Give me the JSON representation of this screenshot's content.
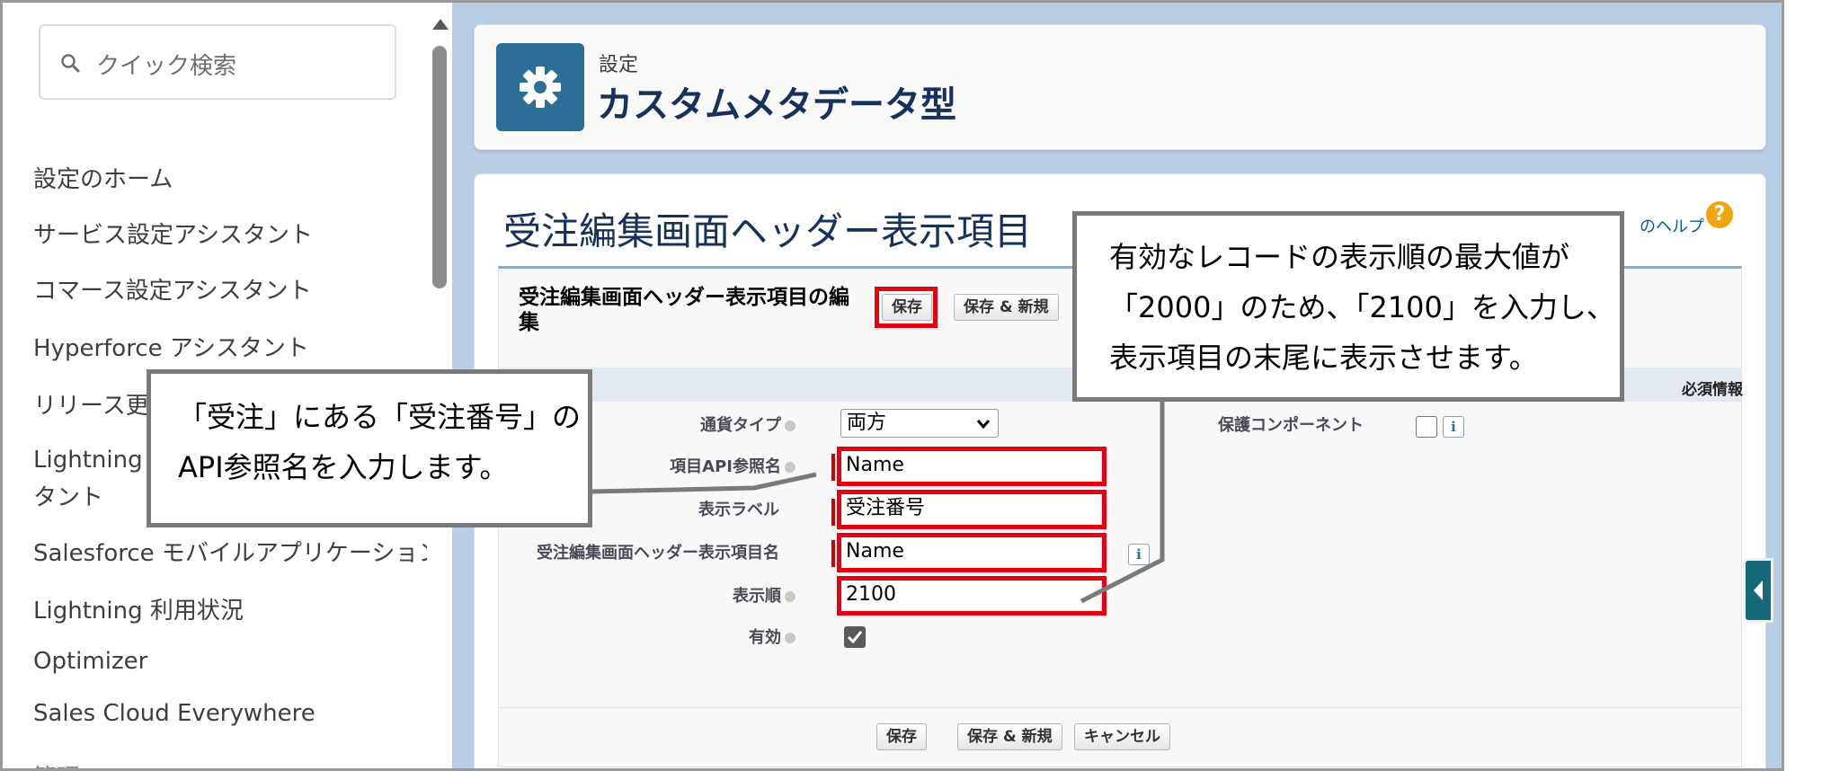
{
  "sidebar": {
    "search_placeholder": "クイック検索",
    "items": [
      "設定のホーム",
      "サービス設定アシスタント",
      "コマース設定アシスタント",
      "Hyperforce アシスタント",
      "リリース更",
      "Lightning E",
      "タント",
      "Salesforce モバイルアプリケーション",
      "Lightning 利用状況",
      "Optimizer",
      "Sales Cloud Everywhere",
      "管理"
    ]
  },
  "header": {
    "subtitle": "設定",
    "title": "カスタムメタデータ型"
  },
  "page": {
    "title": "受注編集画面ヘッダー表示項目",
    "help_link": "のヘルプ",
    "help_icon": "?"
  },
  "edit": {
    "title": "受注編集画面ヘッダー表示項目の編集",
    "top_buttons": {
      "save": "保存",
      "save_new": "保存 & 新規"
    },
    "required_info": "必須情報",
    "fields": {
      "currency_label": "通貨タイプ",
      "currency_value": "両方",
      "api_label": "項目API参照名",
      "api_value": "Name",
      "display_label_label": "表示ラベル",
      "display_label_value": "受注番号",
      "name_label": "受注編集画面ヘッダー表示項目名",
      "name_value": "Name",
      "order_label": "表示順",
      "order_value": "2100",
      "active_label": "有効",
      "active_checked": true,
      "protected_label": "保護コンポーネント",
      "protected_checked": false,
      "info_glyph": "i"
    },
    "bottom_buttons": {
      "save": "保存",
      "save_new": "保存 & 新規",
      "cancel": "キャンセル"
    }
  },
  "callouts": {
    "left": [
      "「受注」にある「受注番号」の",
      "API参照名を入力します。"
    ],
    "right": [
      "有効なレコードの表示順の最大値が",
      "「2000」のため、「2100」を入力し、",
      "表示項目の末尾に表示させます。"
    ]
  },
  "colors": {
    "highlight_box": "#e60012",
    "callout_border": "#7a7a7a",
    "brand_tile": "#2b6f96",
    "main_background": "#b8cde6"
  },
  "icons": {
    "search": "search-icon",
    "gear": "gear-icon",
    "help": "help-icon",
    "collapse": "chevron-left-icon"
  }
}
